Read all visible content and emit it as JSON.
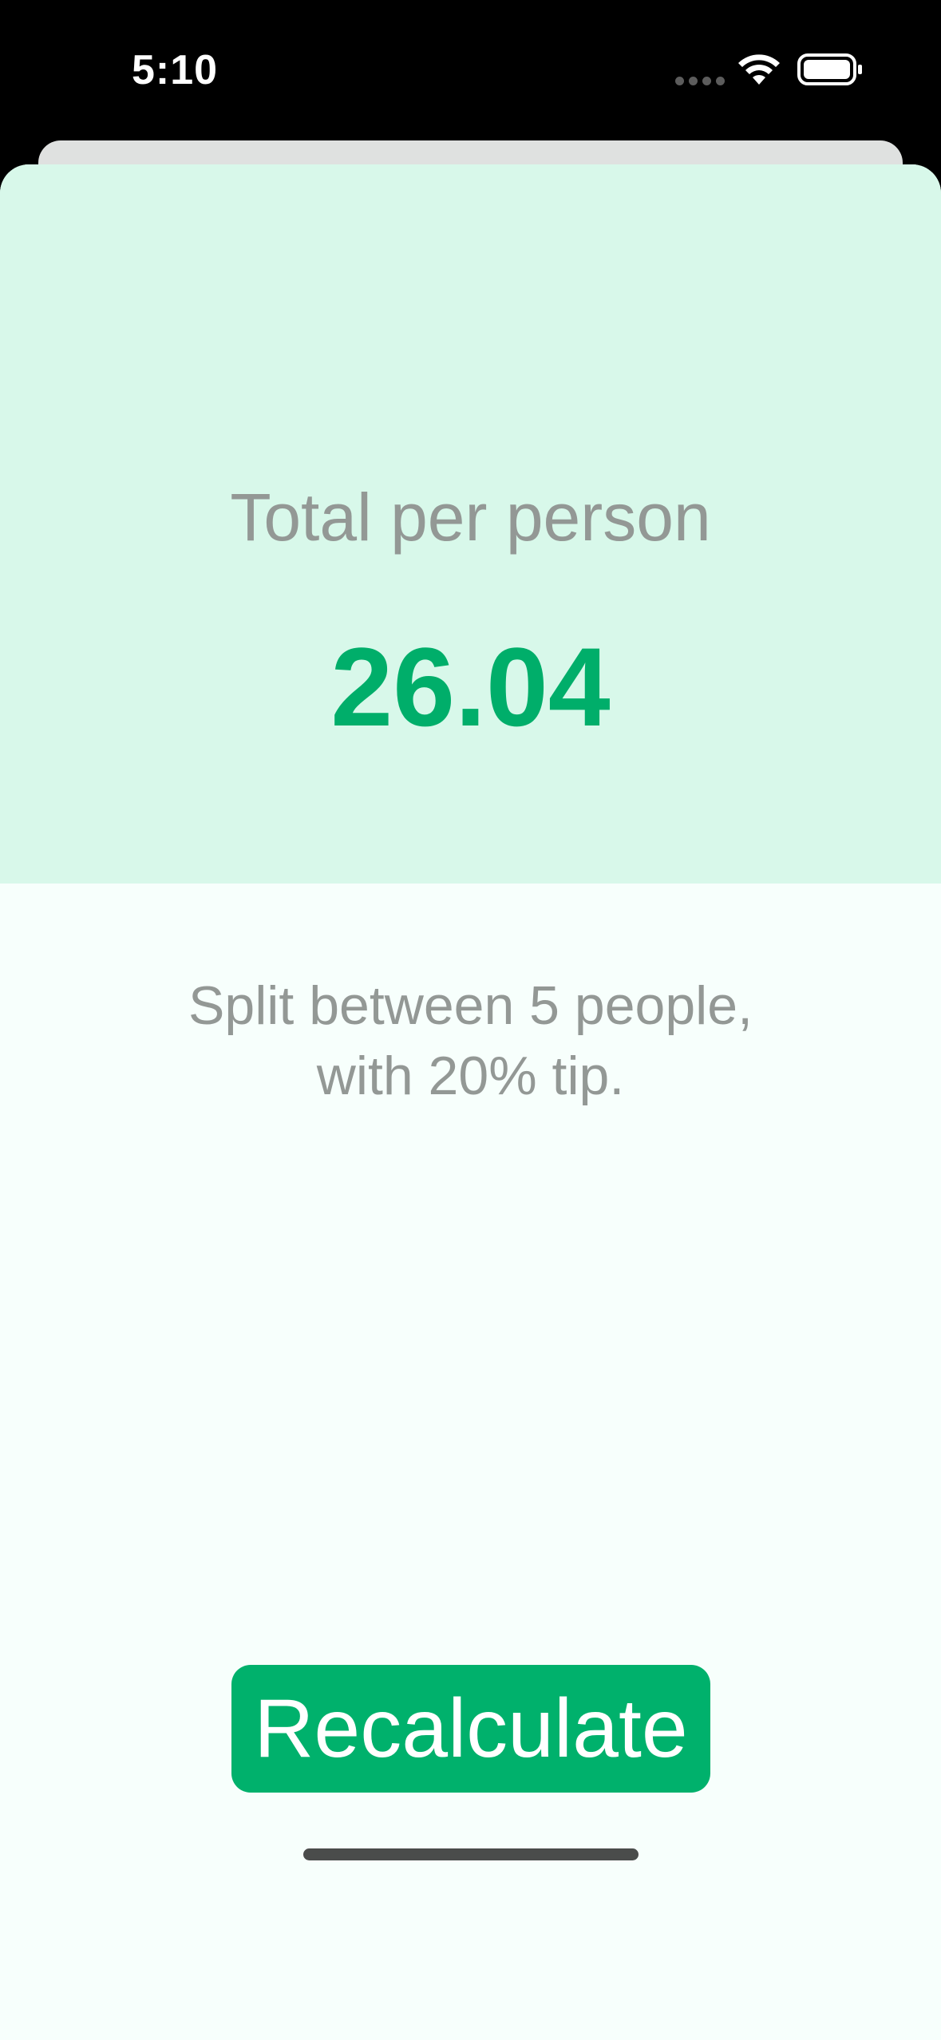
{
  "status_bar": {
    "time": "5:10",
    "icons": [
      "signal-dots-icon",
      "wifi-icon",
      "battery-icon"
    ]
  },
  "result": {
    "total_label": "Total per person",
    "total_value": "26.04",
    "split_line1": "Split between 5 people,",
    "split_line2": "with 20% tip."
  },
  "actions": {
    "recalculate_label": "Recalculate"
  },
  "colors": {
    "accent_green": "#00b16c",
    "result_panel_bg": "#d8f8ea",
    "sheet_bg": "#f7fffc",
    "secondary_text": "#939895"
  }
}
